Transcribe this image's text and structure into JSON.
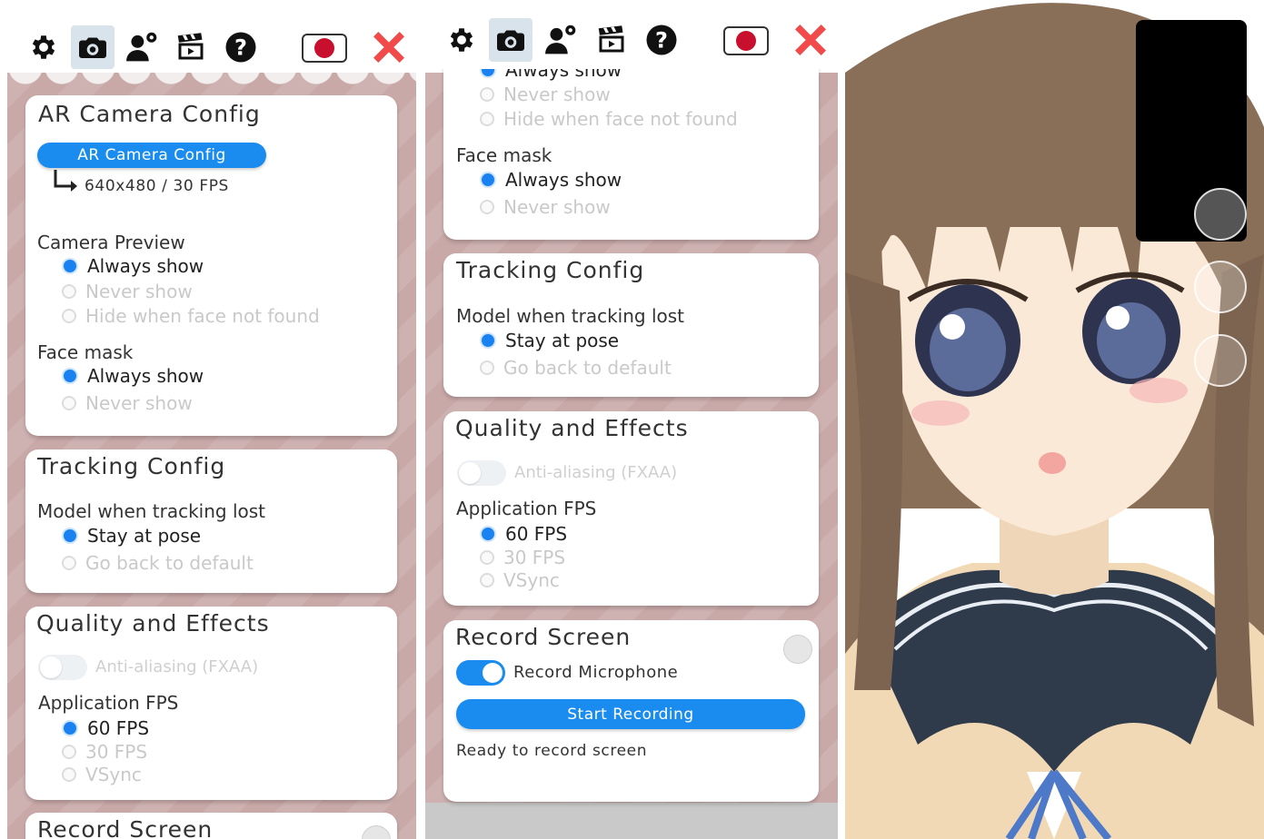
{
  "toolbar": {
    "icons": [
      "gear-icon",
      "camera-icon",
      "user-settings-icon",
      "clapperboard-icon",
      "help-icon",
      "japan-flag-icon",
      "close-icon"
    ],
    "selected": "camera-icon"
  },
  "colors": {
    "accent": "#1a8cf0",
    "close": "#f04a4a",
    "background": "#c9a9a8",
    "flag": "#c8102e"
  },
  "panel1": {
    "ar_camera": {
      "title": "AR Camera Config",
      "button_label": "AR Camera Config",
      "resolution": "640x480 / 30 FPS"
    },
    "camera_preview": {
      "label": "Camera Preview",
      "options": [
        "Always show",
        "Never show",
        "Hide when face not found"
      ],
      "selected": 0
    },
    "face_mask": {
      "label": "Face mask",
      "options": [
        "Always show",
        "Never show"
      ],
      "selected": 0
    },
    "tracking": {
      "title": "Tracking Config",
      "label": "Model when tracking lost",
      "options": [
        "Stay at pose",
        "Go back to default"
      ],
      "selected": 0
    },
    "quality": {
      "title": "Quality and Effects",
      "aa_label": "Anti-aliasing (FXAA)",
      "aa_on": false,
      "fps_label": "Application FPS",
      "fps_options": [
        "60 FPS",
        "30 FPS",
        "VSync"
      ],
      "selected": 0
    },
    "record": {
      "title": "Record Screen"
    }
  },
  "panel2": {
    "camera_preview": {
      "options": [
        "Always show",
        "Never show",
        "Hide when face not found"
      ],
      "selected": 0
    },
    "face_mask": {
      "label": "Face mask",
      "options": [
        "Always show",
        "Never show"
      ],
      "selected": 0
    },
    "tracking": {
      "title": "Tracking Config",
      "label": "Model when tracking lost",
      "options": [
        "Stay at pose",
        "Go back to default"
      ],
      "selected": 0
    },
    "quality": {
      "title": "Quality and Effects",
      "aa_label": "Anti-aliasing (FXAA)",
      "aa_on": false,
      "fps_label": "Application FPS",
      "fps_options": [
        "60 FPS",
        "30 FPS",
        "VSync"
      ],
      "selected": 0
    },
    "record": {
      "title": "Record Screen",
      "mic_label": "Record Microphone",
      "mic_on": true,
      "start_label": "Start Recording",
      "status": "Ready to record screen"
    }
  }
}
